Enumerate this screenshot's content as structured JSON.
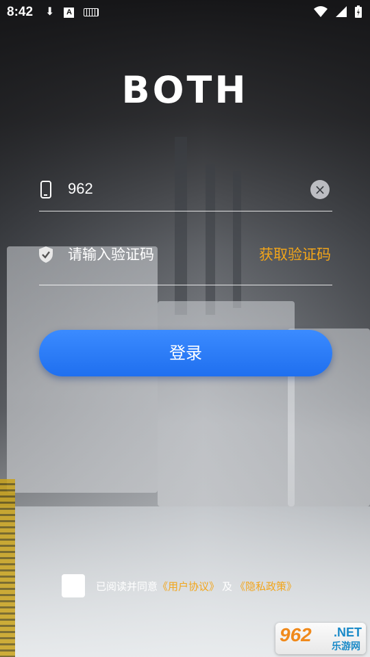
{
  "status_bar": {
    "time": "8:42",
    "icons_left": [
      "download-icon",
      "text-a-icon",
      "keyboard-icon"
    ],
    "icons_right": [
      "wifi-icon",
      "signal-icon",
      "battery-icon"
    ]
  },
  "brand": {
    "logo_text": "BOTH"
  },
  "form": {
    "phone": {
      "icon": "phone-icon",
      "value": "962",
      "clear_icon": "clear-icon"
    },
    "code": {
      "icon": "shield-icon",
      "placeholder": "请输入验证码",
      "get_code_label": "获取验证码"
    },
    "login_label": "登录"
  },
  "agreement": {
    "prefix": "已阅读并同意",
    "user_agreement": "《用户协议》",
    "and": "及",
    "privacy_policy": "《隐私政策》"
  },
  "watermark": {
    "number": "962",
    "domain": ".NET",
    "chinese": "乐游网"
  },
  "colors": {
    "accent_orange": "#f2a51a",
    "button_blue": "#2a7cf7"
  }
}
